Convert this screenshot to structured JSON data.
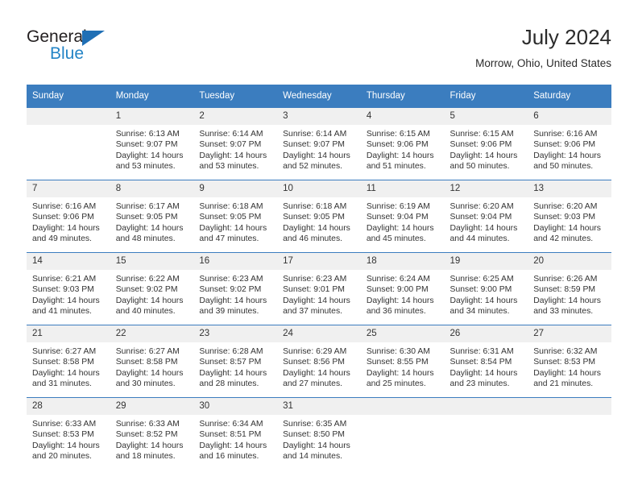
{
  "brand": {
    "name_part1": "General",
    "name_part2": "Blue"
  },
  "header": {
    "title": "July 2024",
    "subtitle": "Morrow, Ohio, United States"
  },
  "calendar": {
    "weekday_headers": [
      "Sunday",
      "Monday",
      "Tuesday",
      "Wednesday",
      "Thursday",
      "Friday",
      "Saturday"
    ],
    "labels": {
      "sunrise": "Sunrise:",
      "sunset": "Sunset:",
      "daylight": "Daylight:"
    },
    "colors": {
      "header_blue": "#3b7dbf",
      "daynum_bg": "#f0f0f0",
      "brand_blue": "#2484c6",
      "text": "#333333"
    },
    "weeks": [
      [
        {
          "blank": true
        },
        {
          "day": "1",
          "sunrise": "Sunrise: 6:13 AM",
          "sunset": "Sunset: 9:07 PM",
          "daylight1": "Daylight: 14 hours",
          "daylight2": "and 53 minutes."
        },
        {
          "day": "2",
          "sunrise": "Sunrise: 6:14 AM",
          "sunset": "Sunset: 9:07 PM",
          "daylight1": "Daylight: 14 hours",
          "daylight2": "and 53 minutes."
        },
        {
          "day": "3",
          "sunrise": "Sunrise: 6:14 AM",
          "sunset": "Sunset: 9:07 PM",
          "daylight1": "Daylight: 14 hours",
          "daylight2": "and 52 minutes."
        },
        {
          "day": "4",
          "sunrise": "Sunrise: 6:15 AM",
          "sunset": "Sunset: 9:06 PM",
          "daylight1": "Daylight: 14 hours",
          "daylight2": "and 51 minutes."
        },
        {
          "day": "5",
          "sunrise": "Sunrise: 6:15 AM",
          "sunset": "Sunset: 9:06 PM",
          "daylight1": "Daylight: 14 hours",
          "daylight2": "and 50 minutes."
        },
        {
          "day": "6",
          "sunrise": "Sunrise: 6:16 AM",
          "sunset": "Sunset: 9:06 PM",
          "daylight1": "Daylight: 14 hours",
          "daylight2": "and 50 minutes."
        }
      ],
      [
        {
          "day": "7",
          "sunrise": "Sunrise: 6:16 AM",
          "sunset": "Sunset: 9:06 PM",
          "daylight1": "Daylight: 14 hours",
          "daylight2": "and 49 minutes."
        },
        {
          "day": "8",
          "sunrise": "Sunrise: 6:17 AM",
          "sunset": "Sunset: 9:05 PM",
          "daylight1": "Daylight: 14 hours",
          "daylight2": "and 48 minutes."
        },
        {
          "day": "9",
          "sunrise": "Sunrise: 6:18 AM",
          "sunset": "Sunset: 9:05 PM",
          "daylight1": "Daylight: 14 hours",
          "daylight2": "and 47 minutes."
        },
        {
          "day": "10",
          "sunrise": "Sunrise: 6:18 AM",
          "sunset": "Sunset: 9:05 PM",
          "daylight1": "Daylight: 14 hours",
          "daylight2": "and 46 minutes."
        },
        {
          "day": "11",
          "sunrise": "Sunrise: 6:19 AM",
          "sunset": "Sunset: 9:04 PM",
          "daylight1": "Daylight: 14 hours",
          "daylight2": "and 45 minutes."
        },
        {
          "day": "12",
          "sunrise": "Sunrise: 6:20 AM",
          "sunset": "Sunset: 9:04 PM",
          "daylight1": "Daylight: 14 hours",
          "daylight2": "and 44 minutes."
        },
        {
          "day": "13",
          "sunrise": "Sunrise: 6:20 AM",
          "sunset": "Sunset: 9:03 PM",
          "daylight1": "Daylight: 14 hours",
          "daylight2": "and 42 minutes."
        }
      ],
      [
        {
          "day": "14",
          "sunrise": "Sunrise: 6:21 AM",
          "sunset": "Sunset: 9:03 PM",
          "daylight1": "Daylight: 14 hours",
          "daylight2": "and 41 minutes."
        },
        {
          "day": "15",
          "sunrise": "Sunrise: 6:22 AM",
          "sunset": "Sunset: 9:02 PM",
          "daylight1": "Daylight: 14 hours",
          "daylight2": "and 40 minutes."
        },
        {
          "day": "16",
          "sunrise": "Sunrise: 6:23 AM",
          "sunset": "Sunset: 9:02 PM",
          "daylight1": "Daylight: 14 hours",
          "daylight2": "and 39 minutes."
        },
        {
          "day": "17",
          "sunrise": "Sunrise: 6:23 AM",
          "sunset": "Sunset: 9:01 PM",
          "daylight1": "Daylight: 14 hours",
          "daylight2": "and 37 minutes."
        },
        {
          "day": "18",
          "sunrise": "Sunrise: 6:24 AM",
          "sunset": "Sunset: 9:00 PM",
          "daylight1": "Daylight: 14 hours",
          "daylight2": "and 36 minutes."
        },
        {
          "day": "19",
          "sunrise": "Sunrise: 6:25 AM",
          "sunset": "Sunset: 9:00 PM",
          "daylight1": "Daylight: 14 hours",
          "daylight2": "and 34 minutes."
        },
        {
          "day": "20",
          "sunrise": "Sunrise: 6:26 AM",
          "sunset": "Sunset: 8:59 PM",
          "daylight1": "Daylight: 14 hours",
          "daylight2": "and 33 minutes."
        }
      ],
      [
        {
          "day": "21",
          "sunrise": "Sunrise: 6:27 AM",
          "sunset": "Sunset: 8:58 PM",
          "daylight1": "Daylight: 14 hours",
          "daylight2": "and 31 minutes."
        },
        {
          "day": "22",
          "sunrise": "Sunrise: 6:27 AM",
          "sunset": "Sunset: 8:58 PM",
          "daylight1": "Daylight: 14 hours",
          "daylight2": "and 30 minutes."
        },
        {
          "day": "23",
          "sunrise": "Sunrise: 6:28 AM",
          "sunset": "Sunset: 8:57 PM",
          "daylight1": "Daylight: 14 hours",
          "daylight2": "and 28 minutes."
        },
        {
          "day": "24",
          "sunrise": "Sunrise: 6:29 AM",
          "sunset": "Sunset: 8:56 PM",
          "daylight1": "Daylight: 14 hours",
          "daylight2": "and 27 minutes."
        },
        {
          "day": "25",
          "sunrise": "Sunrise: 6:30 AM",
          "sunset": "Sunset: 8:55 PM",
          "daylight1": "Daylight: 14 hours",
          "daylight2": "and 25 minutes."
        },
        {
          "day": "26",
          "sunrise": "Sunrise: 6:31 AM",
          "sunset": "Sunset: 8:54 PM",
          "daylight1": "Daylight: 14 hours",
          "daylight2": "and 23 minutes."
        },
        {
          "day": "27",
          "sunrise": "Sunrise: 6:32 AM",
          "sunset": "Sunset: 8:53 PM",
          "daylight1": "Daylight: 14 hours",
          "daylight2": "and 21 minutes."
        }
      ],
      [
        {
          "day": "28",
          "sunrise": "Sunrise: 6:33 AM",
          "sunset": "Sunset: 8:53 PM",
          "daylight1": "Daylight: 14 hours",
          "daylight2": "and 20 minutes."
        },
        {
          "day": "29",
          "sunrise": "Sunrise: 6:33 AM",
          "sunset": "Sunset: 8:52 PM",
          "daylight1": "Daylight: 14 hours",
          "daylight2": "and 18 minutes."
        },
        {
          "day": "30",
          "sunrise": "Sunrise: 6:34 AM",
          "sunset": "Sunset: 8:51 PM",
          "daylight1": "Daylight: 14 hours",
          "daylight2": "and 16 minutes."
        },
        {
          "day": "31",
          "sunrise": "Sunrise: 6:35 AM",
          "sunset": "Sunset: 8:50 PM",
          "daylight1": "Daylight: 14 hours",
          "daylight2": "and 14 minutes."
        },
        {
          "blank": true
        },
        {
          "blank": true
        },
        {
          "blank": true
        }
      ]
    ]
  }
}
